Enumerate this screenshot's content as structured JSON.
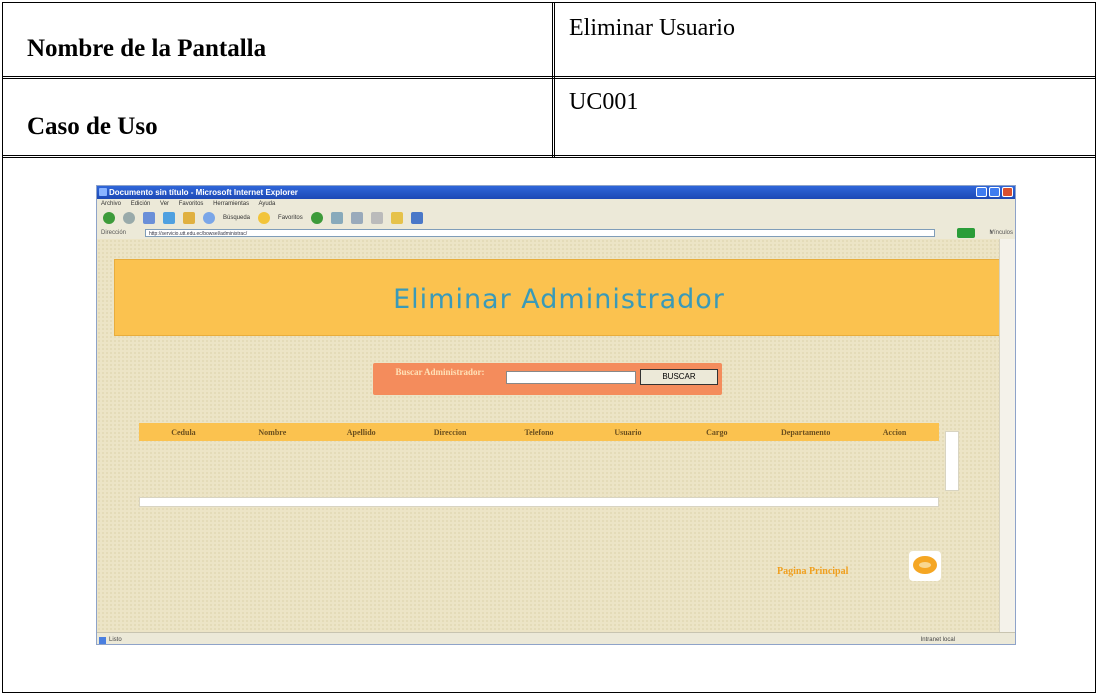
{
  "rows": [
    {
      "label": "Nombre de la Pantalla",
      "value": "Eliminar Usuario"
    },
    {
      "label": "Caso de Uso",
      "value": "UC001"
    }
  ],
  "screenshot": {
    "window_title": "Documento sin título - Microsoft Internet Explorer",
    "menu": [
      "Archivo",
      "Edición",
      "Ver",
      "Favoritos",
      "Herramientas",
      "Ayuda"
    ],
    "toolbar_items": [
      "Búsqueda",
      "Favoritos"
    ],
    "address_label": "Dirección",
    "address_url": "http://servicio.utt.edu.ec/bowsel/administrac/",
    "address_go": "Ir",
    "address_links": "Vínculos",
    "banner_title": "Eliminar Administrador",
    "search_label": "Buscar Administrador:",
    "search_button": "BUSCAR",
    "columns": [
      "Cedula",
      "Nombre",
      "Apellido",
      "Direccion",
      "Telefono",
      "Usuario",
      "Cargo",
      "Departamento",
      "Accion"
    ],
    "main_link": "Pagina Principal",
    "status_left": "Listo",
    "status_zone": "Intranet local",
    "colors": {
      "banner": "#fbc24f",
      "search_bar": "#f48c5c",
      "title_text": "#3a9ab8",
      "link": "#f0a020"
    }
  }
}
